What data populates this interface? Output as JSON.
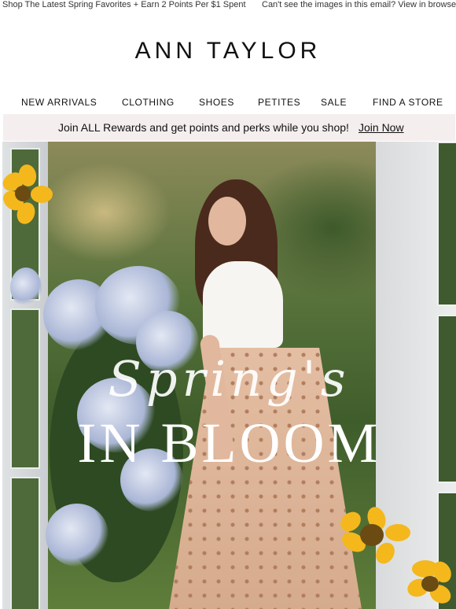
{
  "preheader": {
    "promo": "Shop The Latest Spring Favorites + Earn 2 Points Per $1 Spent",
    "view_browser": "Can't see the images in this email? View in browser."
  },
  "brand": {
    "logo": "ANN TAYLOR"
  },
  "nav": {
    "items": [
      "NEW ARRIVALS",
      "CLOTHING",
      "SHOES",
      "PETITES",
      "SALE",
      "FIND A STORE"
    ]
  },
  "rewards": {
    "message": "Join ALL Rewards and get points and perks while you shop!",
    "cta": "Join Now",
    "background": "#f5eeee"
  },
  "hero": {
    "script_text": "Spring's",
    "headline": "IN BLOOM",
    "image_subject": "woman-in-eyelet-skirt-among-hydrangeas"
  }
}
